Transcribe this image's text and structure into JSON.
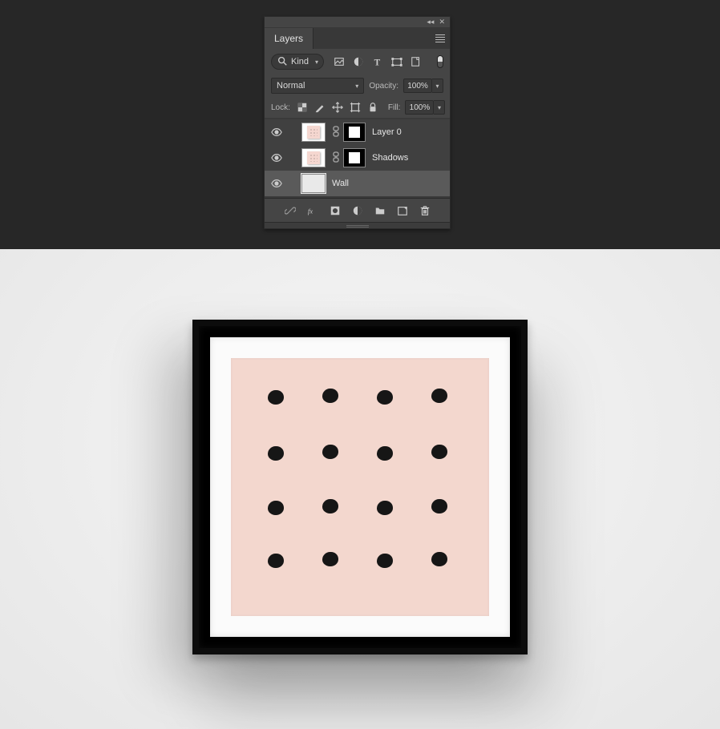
{
  "panel": {
    "title": "Layers",
    "filter": {
      "kind_label": "Kind"
    },
    "blend": {
      "mode": "Normal",
      "opacity_label": "Opacity:",
      "opacity_value": "100%"
    },
    "lock": {
      "label": "Lock:",
      "fill_label": "Fill:",
      "fill_value": "100%"
    },
    "layers": [
      {
        "name": "Layer 0",
        "visible": true,
        "has_mask": true,
        "selected": false,
        "thumb": "pink-dots"
      },
      {
        "name": "Shadows",
        "visible": true,
        "has_mask": true,
        "selected": false,
        "thumb": "pink-dots"
      },
      {
        "name": "Wall",
        "visible": true,
        "has_mask": false,
        "selected": true,
        "thumb": "texture"
      }
    ]
  }
}
